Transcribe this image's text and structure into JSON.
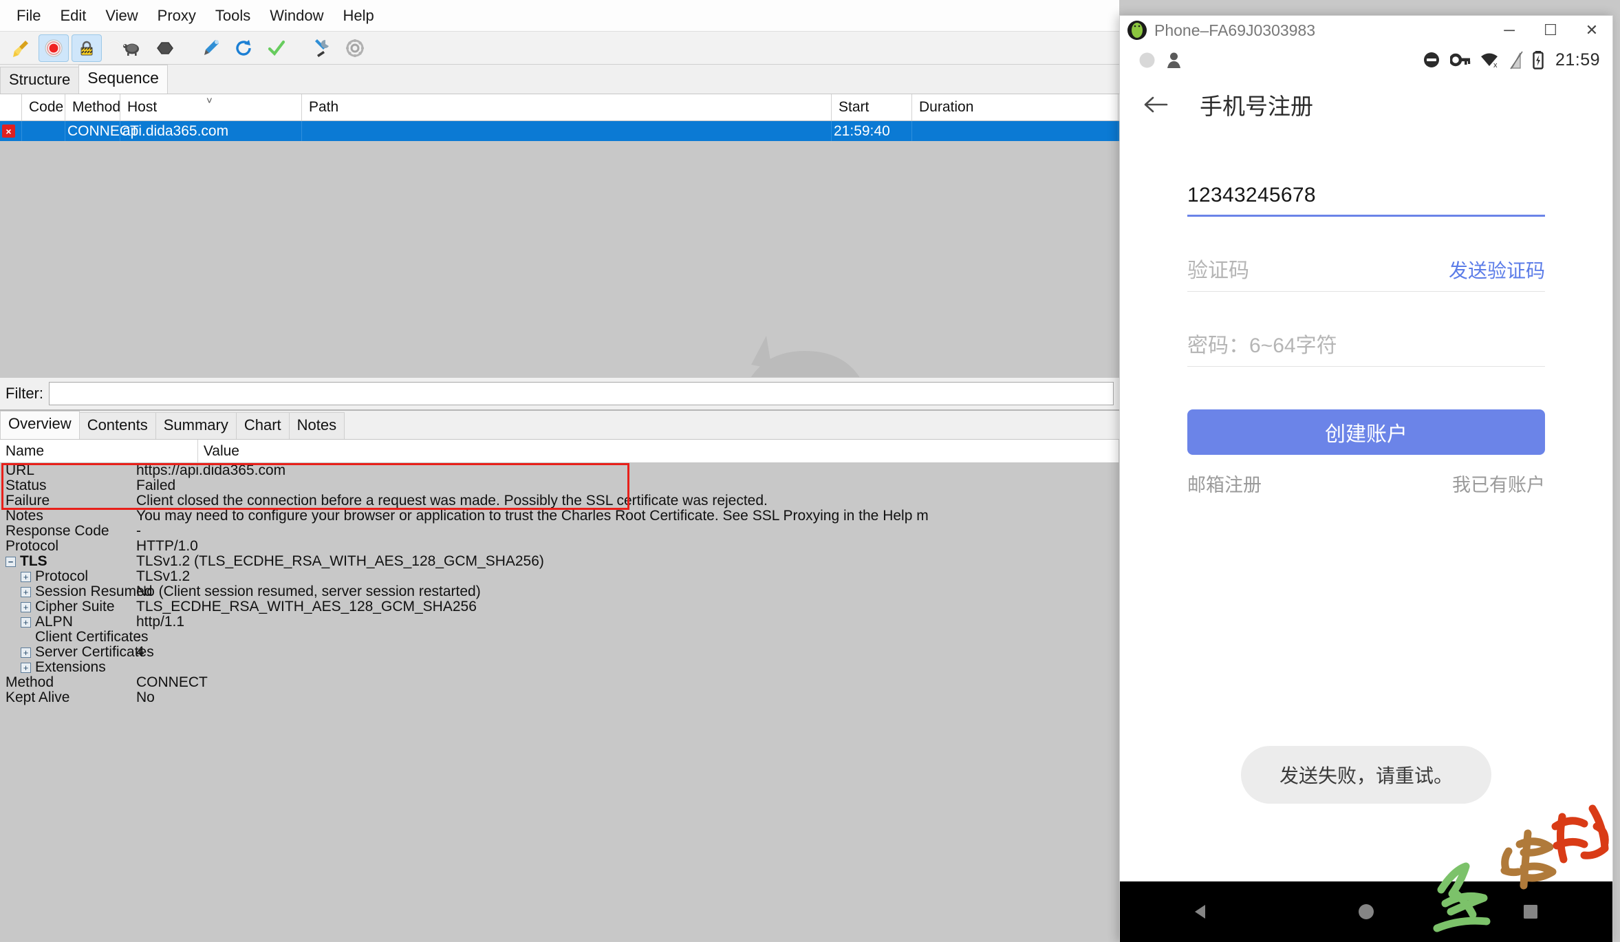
{
  "app": {
    "name": "Charles Proxy",
    "menubar": [
      {
        "label": "File"
      },
      {
        "label": "Edit"
      },
      {
        "label": "View"
      },
      {
        "label": "Proxy"
      },
      {
        "label": "Tools"
      },
      {
        "label": "Window"
      },
      {
        "label": "Help"
      }
    ],
    "toolbar": [
      {
        "name": "clear-session-icon",
        "title": "Clear Session",
        "pressed": false
      },
      {
        "name": "record-icon",
        "title": "Start/Stop Recording",
        "pressed": true
      },
      {
        "name": "ssl-proxying-icon",
        "title": "Enable SSL Proxying",
        "pressed": true
      },
      {
        "name": "throttle-turtle-icon",
        "title": "Start/Stop Throttling",
        "pressed": false
      },
      {
        "name": "breakpoints-icon",
        "title": "Enable Breakpoints",
        "pressed": false
      },
      {
        "name": "compose-icon",
        "title": "Compose a New Request",
        "pressed": false
      },
      {
        "name": "repeat-icon",
        "title": "Repeat",
        "pressed": false
      },
      {
        "name": "validate-icon",
        "title": "Validate",
        "pressed": false
      },
      {
        "name": "tools-icon",
        "title": "Tools",
        "pressed": false
      },
      {
        "name": "settings-gear-icon",
        "title": "Settings",
        "pressed": false
      }
    ],
    "view_tabs": [
      {
        "label": "Structure",
        "selected": false
      },
      {
        "label": "Sequence",
        "selected": true
      }
    ],
    "session_table": {
      "columns": [
        "",
        "Code",
        "Method",
        "Host",
        "Path",
        "Start",
        "Duration"
      ],
      "rows": [
        {
          "status_icon": "error-x-icon",
          "status_glyph": "×",
          "code": "",
          "method": "CONNECT",
          "host": "api.dida365.com",
          "path": "",
          "start": "21:59:40",
          "duration": "",
          "selected": true
        }
      ]
    },
    "filter": {
      "label": "Filter:",
      "value": "",
      "placeholder": ""
    },
    "detail_tabs": [
      {
        "label": "Overview",
        "selected": true
      },
      {
        "label": "Contents",
        "selected": false
      },
      {
        "label": "Summary",
        "selected": false
      },
      {
        "label": "Chart",
        "selected": false
      },
      {
        "label": "Notes",
        "selected": false
      }
    ],
    "detail_table": {
      "columns": [
        "Name",
        "Value"
      ],
      "rows": [
        {
          "name": "URL",
          "value": "https://api.dida365.com",
          "indent": 0,
          "twisty": "",
          "highlighted": true
        },
        {
          "name": "Status",
          "value": "Failed",
          "indent": 0,
          "twisty": "",
          "highlighted": true
        },
        {
          "name": "Failure",
          "value": "Client closed the connection before a request was made. Possibly the SSL certificate was rejected.",
          "indent": 0,
          "twisty": "",
          "highlighted": true
        },
        {
          "name": "Notes",
          "value": "You may need to configure your browser or application to trust the Charles Root Certificate. See SSL Proxying in the Help m",
          "indent": 0,
          "twisty": "",
          "highlighted": false
        },
        {
          "name": "Response Code",
          "value": "-",
          "indent": 0,
          "twisty": "",
          "highlighted": false
        },
        {
          "name": "Protocol",
          "value": "HTTP/1.0",
          "indent": 0,
          "twisty": "",
          "highlighted": false
        },
        {
          "name": "TLS",
          "value": "TLSv1.2 (TLS_ECDHE_RSA_WITH_AES_128_GCM_SHA256)",
          "indent": 0,
          "twisty": "minus",
          "bold": true,
          "highlighted": false
        },
        {
          "name": "Protocol",
          "value": "TLSv1.2",
          "indent": 1,
          "twisty": "plus",
          "highlighted": false
        },
        {
          "name": "Session Resumed",
          "value": "No (Client session resumed, server session restarted)",
          "indent": 1,
          "twisty": "plus",
          "highlighted": false
        },
        {
          "name": "Cipher Suite",
          "value": "TLS_ECDHE_RSA_WITH_AES_128_GCM_SHA256",
          "indent": 1,
          "twisty": "plus",
          "highlighted": false
        },
        {
          "name": "ALPN",
          "value": "http/1.1",
          "indent": 1,
          "twisty": "plus",
          "highlighted": false
        },
        {
          "name": "Client Certificates",
          "value": "-",
          "indent": 1,
          "twisty": "",
          "highlighted": false
        },
        {
          "name": "Server Certificates",
          "value": "4",
          "indent": 1,
          "twisty": "plus",
          "highlighted": false
        },
        {
          "name": "Extensions",
          "value": "",
          "indent": 1,
          "twisty": "plus",
          "highlighted": false
        },
        {
          "name": "Method",
          "value": "CONNECT",
          "indent": 0,
          "twisty": "",
          "highlighted": false
        },
        {
          "name": "Kept Alive",
          "value": "No",
          "indent": 0,
          "twisty": "",
          "highlighted": false
        }
      ]
    }
  },
  "phone_window": {
    "title": "Phone–FA69J0303983",
    "icon": "android-robot-icon",
    "window_buttons": [
      {
        "name": "minimize-button",
        "glyph": "─"
      },
      {
        "name": "maximize-button",
        "glyph": "☐"
      },
      {
        "name": "close-button",
        "glyph": "✕"
      }
    ],
    "status_bar": {
      "left_icons": [
        "notification-circle-icon",
        "notification-person-icon"
      ],
      "right_icons": [
        "do-not-disturb-icon",
        "vpn-key-icon",
        "wifi-off-icon",
        "signal-off-icon",
        "battery-charging-icon"
      ],
      "clock": "21:59"
    },
    "screen": {
      "back_icon": "back-arrow-icon",
      "title": "手机号注册",
      "fields": [
        {
          "name": "phone-input",
          "value": "12343245678",
          "placeholder": "",
          "focused": true
        },
        {
          "name": "verification-code-input",
          "value": "",
          "placeholder": "验证码",
          "action_label": "发送验证码",
          "focused": false
        },
        {
          "name": "password-input",
          "value": "",
          "placeholder": "密码：6~64字符",
          "focused": false
        }
      ],
      "primary_button": "创建账户",
      "links": [
        {
          "name": "email-register-link",
          "label": "邮箱注册"
        },
        {
          "name": "have-account-link",
          "label": "我已有账户"
        }
      ],
      "toast": "发送失败，请重试。"
    },
    "nav_bar": [
      {
        "name": "nav-back-button",
        "icon": "triangle-back-icon"
      },
      {
        "name": "nav-home-button",
        "icon": "circle-home-icon"
      },
      {
        "name": "nav-recents-button",
        "icon": "square-recents-icon"
      }
    ]
  },
  "colors": {
    "selection_blue": "#0b7ad4",
    "error_red": "#e8201a",
    "android_accent": "#6b84e8",
    "link_blue": "#5b7ce8"
  }
}
